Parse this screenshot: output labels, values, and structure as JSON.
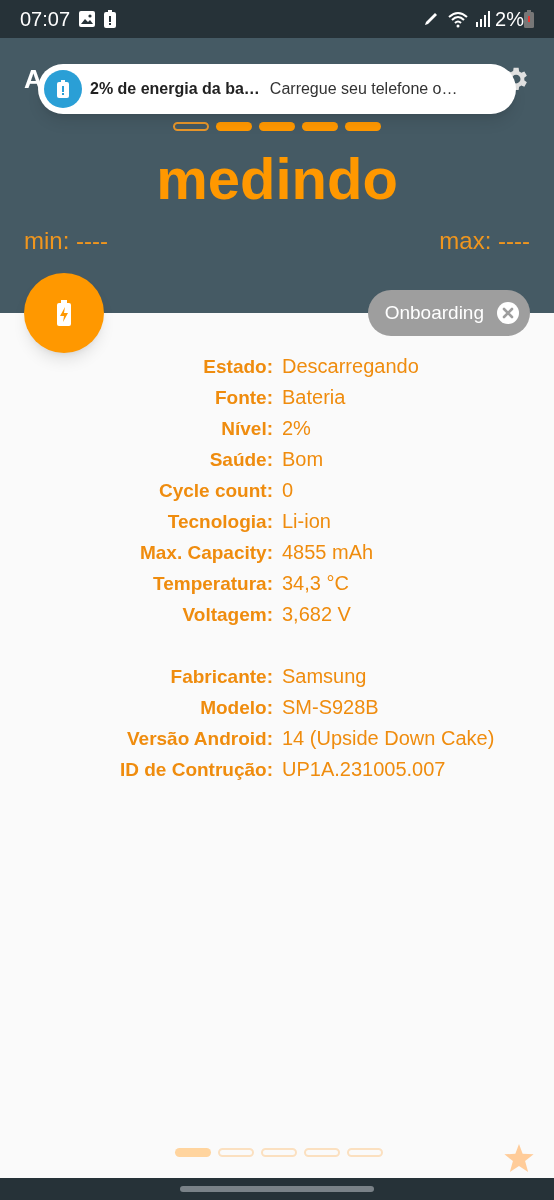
{
  "status_bar": {
    "time": "07:07",
    "battery": "2%"
  },
  "header": {
    "title": "A",
    "status": "medindo",
    "min": "min: ----",
    "max": "max: ----"
  },
  "top_pager": [
    {
      "filled": false
    },
    {
      "filled": true
    },
    {
      "filled": true
    },
    {
      "filled": true
    },
    {
      "filled": true
    }
  ],
  "notification": {
    "title": "2% de energia da ba…",
    "text": "Carregue seu telefone o…"
  },
  "chip": {
    "label": "Onboarding"
  },
  "battery_info": [
    {
      "label": "Estado:",
      "value": "Descarregando"
    },
    {
      "label": "Fonte:",
      "value": "Bateria"
    },
    {
      "label": "Nível:",
      "value": "2%"
    },
    {
      "label": "Saúde:",
      "value": "Bom"
    },
    {
      "label": "Cycle count:",
      "value": "0"
    },
    {
      "label": "Tecnologia:",
      "value": "Li-ion"
    },
    {
      "label": "Max. Capacity:",
      "value": "4855 mAh"
    },
    {
      "label": "Temperatura:",
      "value": "34,3 °C"
    },
    {
      "label": "Voltagem:",
      "value": "3,682 V"
    }
  ],
  "device_info": [
    {
      "label": "Fabricante:",
      "value": "Samsung"
    },
    {
      "label": "Modelo:",
      "value": "SM-S928B"
    },
    {
      "label": "Versão Android:",
      "value": "14 (Upside Down Cake)"
    },
    {
      "label": "ID de Contrução:",
      "value": "UP1A.231005.007"
    }
  ],
  "bottom_pager": [
    {
      "filled": true
    },
    {
      "filled": false
    },
    {
      "filled": false
    },
    {
      "filled": false
    },
    {
      "filled": false
    }
  ]
}
